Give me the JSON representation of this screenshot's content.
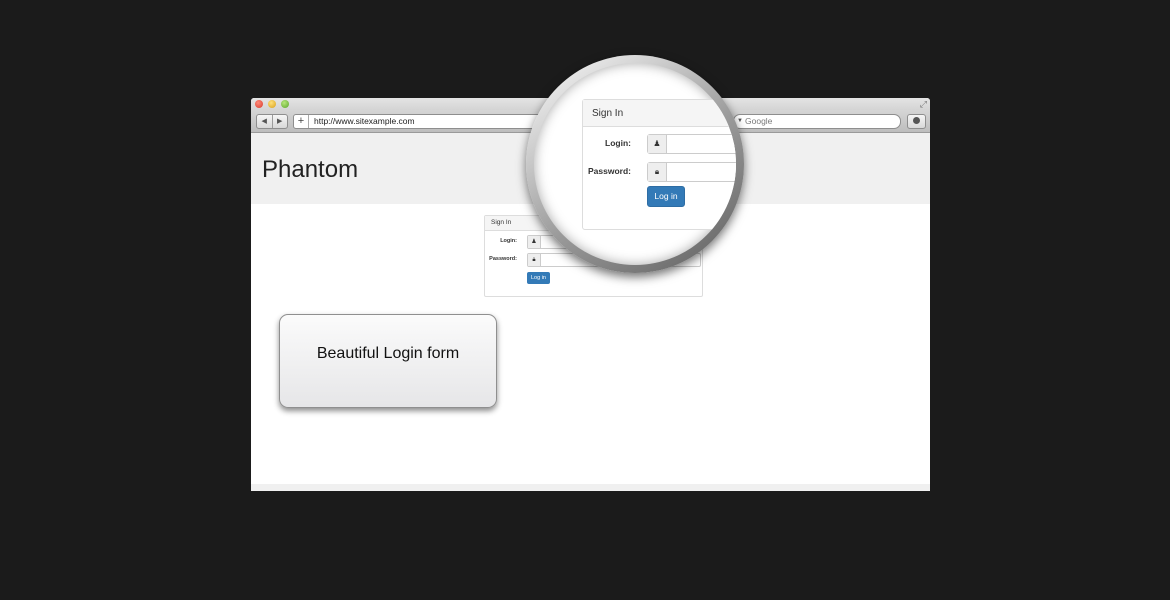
{
  "browser": {
    "url": "http://www.sitexample.com",
    "search_placeholder": "Google",
    "nav_back": "◀",
    "nav_forward": "▶",
    "new_tab": "+",
    "search_icon": "search-icon",
    "download_icon": "download-icon",
    "fullscreen_icon": "⤢"
  },
  "site": {
    "brand": "Phantom"
  },
  "signin": {
    "title": "Sign In",
    "login_label": "Login:",
    "password_label": "Password:",
    "login_icon": "user-icon",
    "password_icon": "lock-icon",
    "submit_label": "Log in"
  },
  "callout": {
    "text": "Beautiful Login form"
  },
  "colors": {
    "background": "#1b1b1b",
    "header": "#f0f0f0",
    "button": "#337ab7"
  }
}
